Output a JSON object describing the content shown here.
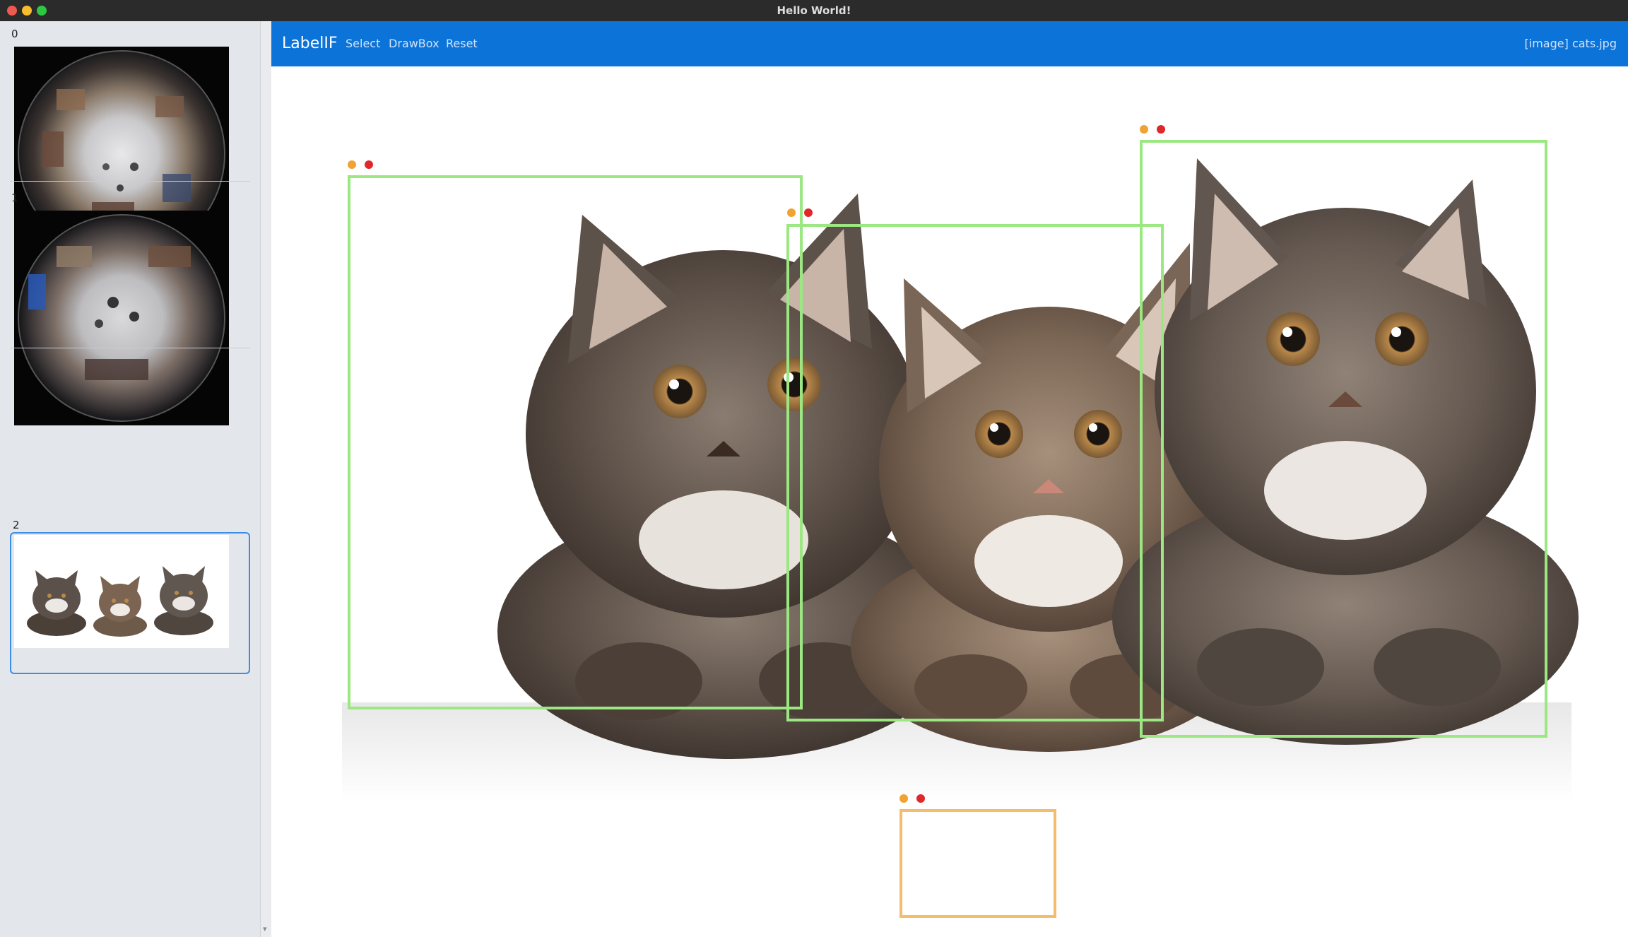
{
  "window": {
    "title": "Hello World!"
  },
  "sidebar": {
    "items": [
      {
        "index": "0",
        "image": "fisheye-store-top-view"
      },
      {
        "index": "1",
        "image": "fisheye-store-interior"
      },
      {
        "index": "2",
        "image": "three-kittens",
        "selected": true
      }
    ]
  },
  "navbar": {
    "brand": "LabelIF",
    "links": [
      "Select",
      "DrawBox",
      "Reset"
    ],
    "current_file": "[image] cats.jpg"
  },
  "canvas": {
    "image": "three-kittens",
    "boxes": [
      {
        "name": "box-1",
        "status": "confirmed"
      },
      {
        "name": "box-2",
        "status": "confirmed"
      },
      {
        "name": "box-3",
        "status": "confirmed"
      },
      {
        "name": "box-4",
        "status": "pending"
      }
    ]
  },
  "colors": {
    "navbar": "#0c73d9",
    "box_confirmed": "#9be782",
    "box_pending": "#f4bd6b",
    "handle_edit": "#f0a233",
    "handle_delete": "#e0272a",
    "selection": "#3a8ee6"
  }
}
